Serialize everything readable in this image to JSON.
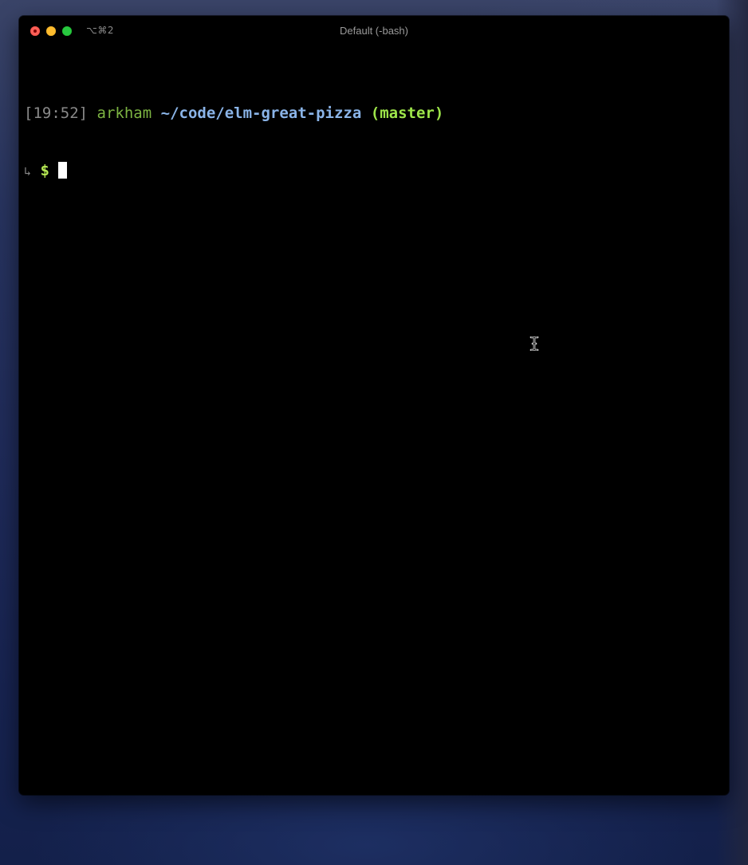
{
  "window": {
    "title": "Default (-bash)",
    "shortcut": "⌥⌘2"
  },
  "terminal": {
    "prompt": {
      "time": "[19:52]",
      "user": "arkham",
      "path": "~/code/elm-great-pizza",
      "branch": "(master)"
    },
    "input_line": {
      "arrow": "↳",
      "symbol": "$",
      "text": ""
    }
  },
  "colors": {
    "background": "#000000",
    "time": "#8a8a8a",
    "user": "#7cb342",
    "path": "#8ab4e8",
    "branch": "#9ee64a",
    "dollar": "#b5e853"
  },
  "icons": {
    "close": "close-icon",
    "minimize": "minimize-icon",
    "maximize": "maximize-icon",
    "mouse_cursor": "ibeam-cursor-icon"
  }
}
